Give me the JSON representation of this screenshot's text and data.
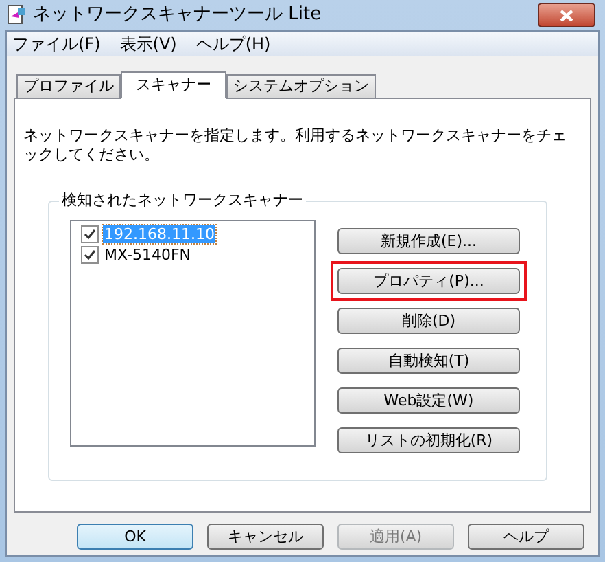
{
  "window": {
    "title": "ネットワークスキャナーツール Lite"
  },
  "menu": [
    "ファイル(F)",
    "表示(V)",
    "ヘルプ(H)"
  ],
  "tabs": [
    {
      "label": "プロファイル",
      "selected": false
    },
    {
      "label": "スキャナー",
      "selected": true
    },
    {
      "label": "システムオプション",
      "selected": false
    }
  ],
  "description": "ネットワークスキャナーを指定します。利用するネットワークスキャナーをチェックしてください。",
  "group": {
    "title": "検知されたネットワークスキャナー",
    "scanners": [
      {
        "name": "192.168.11.10",
        "checked": true,
        "selected": true
      },
      {
        "name": "MX-5140FN",
        "checked": true,
        "selected": false
      }
    ],
    "buttons": [
      {
        "label": "新規作成(E)...",
        "highlighted": false
      },
      {
        "label": "プロパティ(P)...",
        "highlighted": true
      },
      {
        "label": "削除(D)",
        "highlighted": false
      },
      {
        "label": "自動検知(T)",
        "highlighted": false
      },
      {
        "label": "Web設定(W)",
        "highlighted": false
      },
      {
        "label": "リストの初期化(R)",
        "highlighted": false
      }
    ]
  },
  "footer_buttons": [
    {
      "label": "OK",
      "default": true,
      "disabled": false
    },
    {
      "label": "キャンセル",
      "default": false,
      "disabled": false
    },
    {
      "label": "適用(A)",
      "default": false,
      "disabled": true
    },
    {
      "label": "ヘルプ",
      "default": false,
      "disabled": false
    }
  ]
}
